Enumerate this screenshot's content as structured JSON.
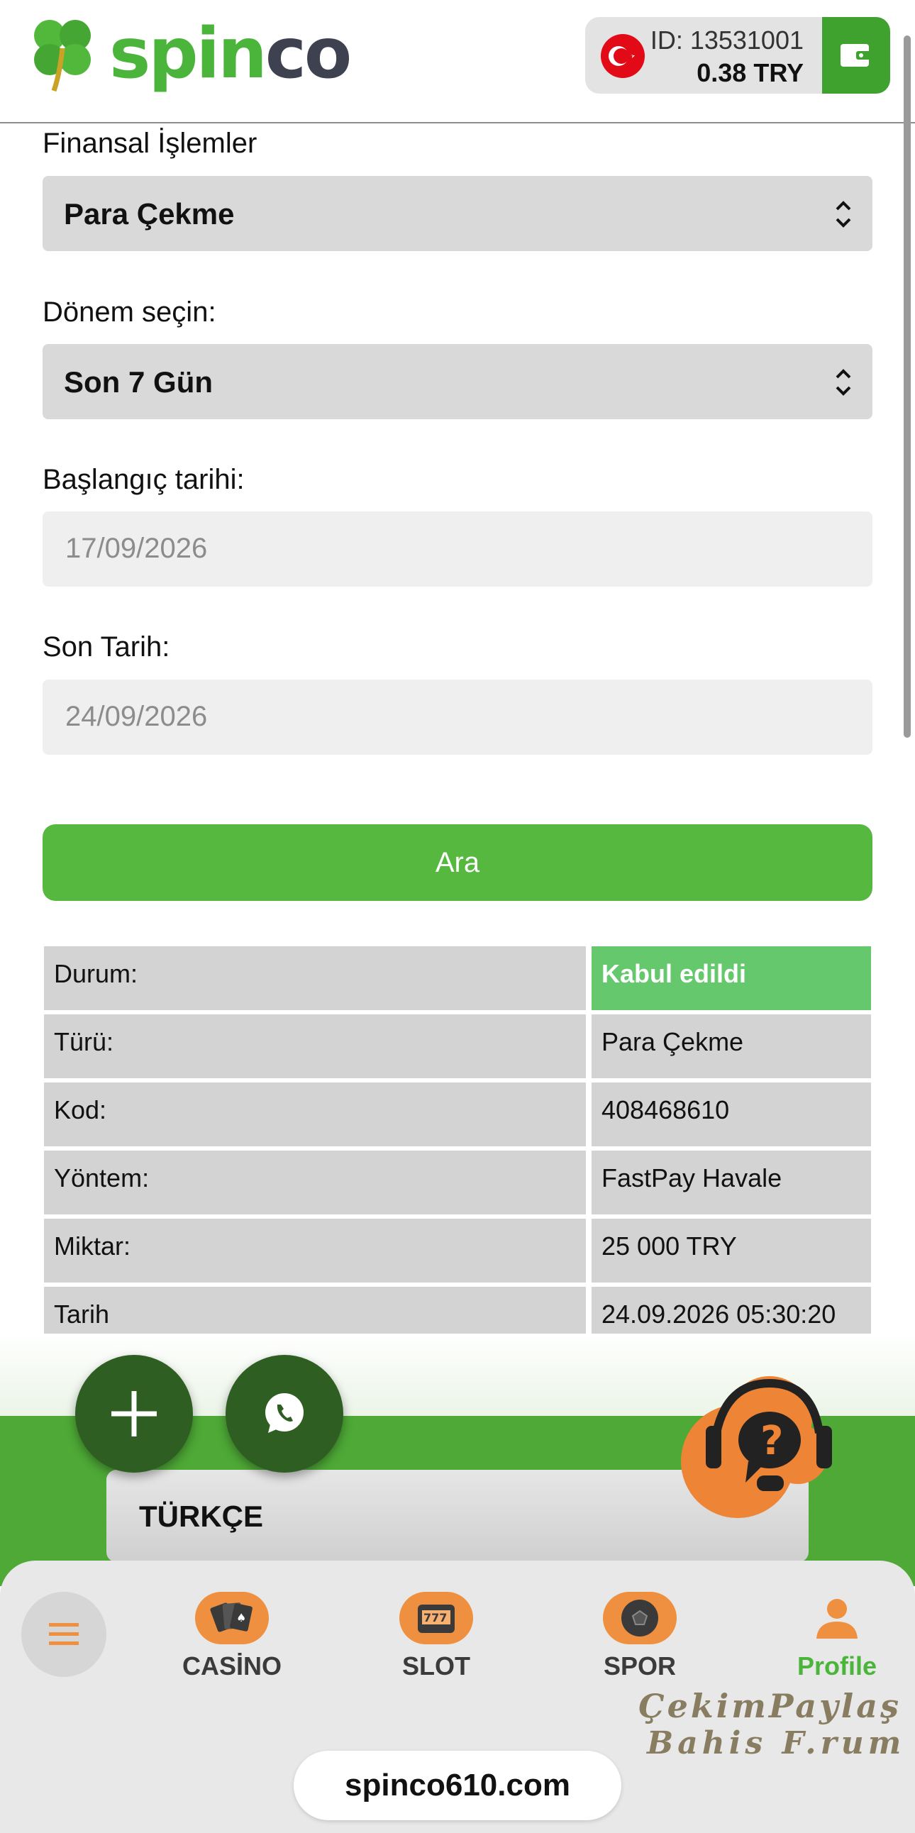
{
  "header": {
    "logo_text_a": "spin",
    "logo_text_b": "co",
    "user_id": "ID: 13531001",
    "balance": "0.38   TRY"
  },
  "form": {
    "financial_label": "Finansal İşlemler",
    "financial_value": "Para Çekme",
    "period_label": "Dönem seçin:",
    "period_value": "Son 7 Gün",
    "start_label": "Başlangıç tarihi:",
    "start_value": "17/09/2026",
    "end_label": "Son Tarih:",
    "end_value": "24/09/2026",
    "search_button": "Ara"
  },
  "transaction": {
    "rows": [
      {
        "label": "Durum:",
        "value": "Kabul edildi"
      },
      {
        "label": "Türü:",
        "value": "Para Çekme"
      },
      {
        "label": "Kod:",
        "value": "408468610"
      },
      {
        "label": "Yöntem:",
        "value": "FastPay Havale"
      },
      {
        "label": "Miktar:",
        "value": "25 000 TRY"
      },
      {
        "label": "Tarih",
        "value": "24.09.2026 05:30:20"
      }
    ]
  },
  "footer": {
    "language": "TÜRKÇE"
  },
  "nav": {
    "items": [
      {
        "label": "CASİNO",
        "icon": "cards-icon"
      },
      {
        "label": "SLOT",
        "icon": "slot-machine-icon"
      },
      {
        "label": "SPOR",
        "icon": "soccer-ball-icon"
      },
      {
        "label": "Profile",
        "icon": "user-icon"
      }
    ]
  },
  "url": "spinco610.com",
  "watermark": {
    "line1": "ÇekimPaylaş",
    "line2": "Bahis F.rum"
  },
  "colors": {
    "brand_green": "#4ab53a",
    "accent_orange": "#ef8f40",
    "status_green": "#65c86d"
  }
}
